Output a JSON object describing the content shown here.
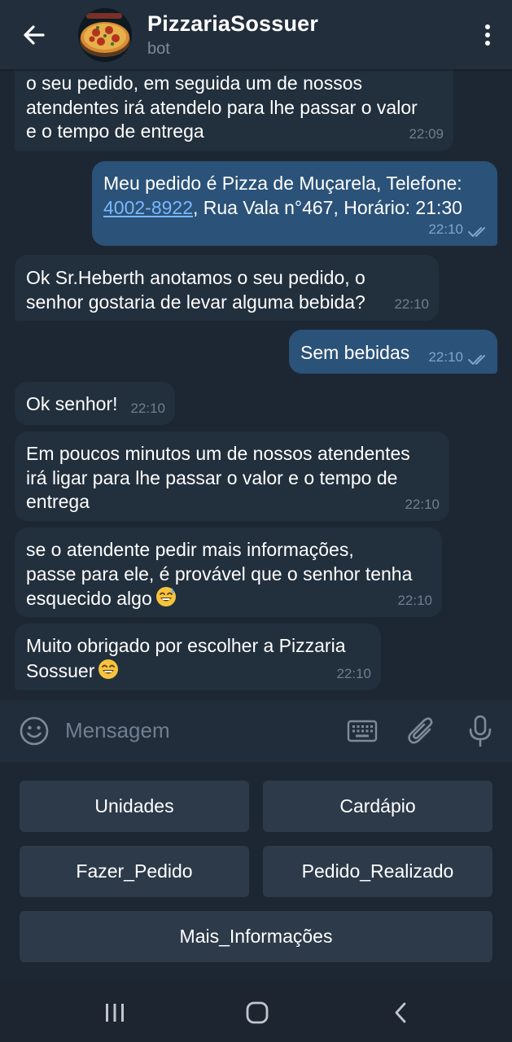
{
  "header": {
    "title": "PizzariaSossuer",
    "subtitle": "bot"
  },
  "messages": [
    {
      "direction": "in",
      "lines": [
        "o seu pedido, em seguida um de nossos",
        "atendentes irá atendelo para lhe passar o valor",
        "e o tempo de entrega"
      ],
      "time": "22:09"
    },
    {
      "direction": "out",
      "line1": "Meu pedido é Pizza de Muçarela, Telefone:",
      "phone": "4002-8922",
      "line2_rest": ", Rua Vala n°467, Horário: 21:30",
      "time": "22:10",
      "status": "read"
    },
    {
      "direction": "in",
      "lines": [
        "Ok Sr.Heberth anotamos o seu pedido, o",
        "senhor gostaria de levar alguma bebida?"
      ],
      "time": "22:10"
    },
    {
      "direction": "out",
      "lines": [
        "Sem bebidas"
      ],
      "time": "22:10",
      "status": "read"
    },
    {
      "direction": "in",
      "lines": [
        "Ok senhor!"
      ],
      "time": "22:10"
    },
    {
      "direction": "in",
      "lines": [
        "Em poucos minutos um de nossos atendentes",
        "irá ligar para lhe passar o valor e o tempo de",
        "entrega"
      ],
      "time": "22:10"
    },
    {
      "direction": "in",
      "lines": [
        "se o atendente pedir mais informações,",
        "passe para ele, é provável que o senhor tenha",
        "esquecido algo"
      ],
      "emoji": "grinning-sweat-emoji",
      "time": "22:10"
    },
    {
      "direction": "in",
      "lines": [
        "Muito obrigado por escolher a Pizzaria",
        "Sossuer"
      ],
      "emoji": "grinning-emoji",
      "time": "22:10"
    }
  ],
  "input": {
    "placeholder": "Mensagem"
  },
  "keyboard": {
    "buttons": [
      "Unidades",
      "Cardápio",
      "Fazer_Pedido",
      "Pedido_Realizado",
      "Mais_Informações"
    ]
  },
  "icons": {
    "back": "arrow-left-icon",
    "menu": "more-vertical-icon",
    "emoji": "smiley-icon",
    "keyboard": "keyboard-icon",
    "attach": "paperclip-icon",
    "mic": "microphone-icon",
    "nav_recent": "recent-apps-icon",
    "nav_home": "home-icon",
    "nav_back": "nav-back-icon"
  },
  "colors": {
    "background": "#1d2733",
    "header": "#232e3c",
    "incoming_bubble": "#222f3d",
    "outgoing_bubble": "#2b5278",
    "link": "#79b8ff",
    "read_check": "#7ea6cc"
  }
}
